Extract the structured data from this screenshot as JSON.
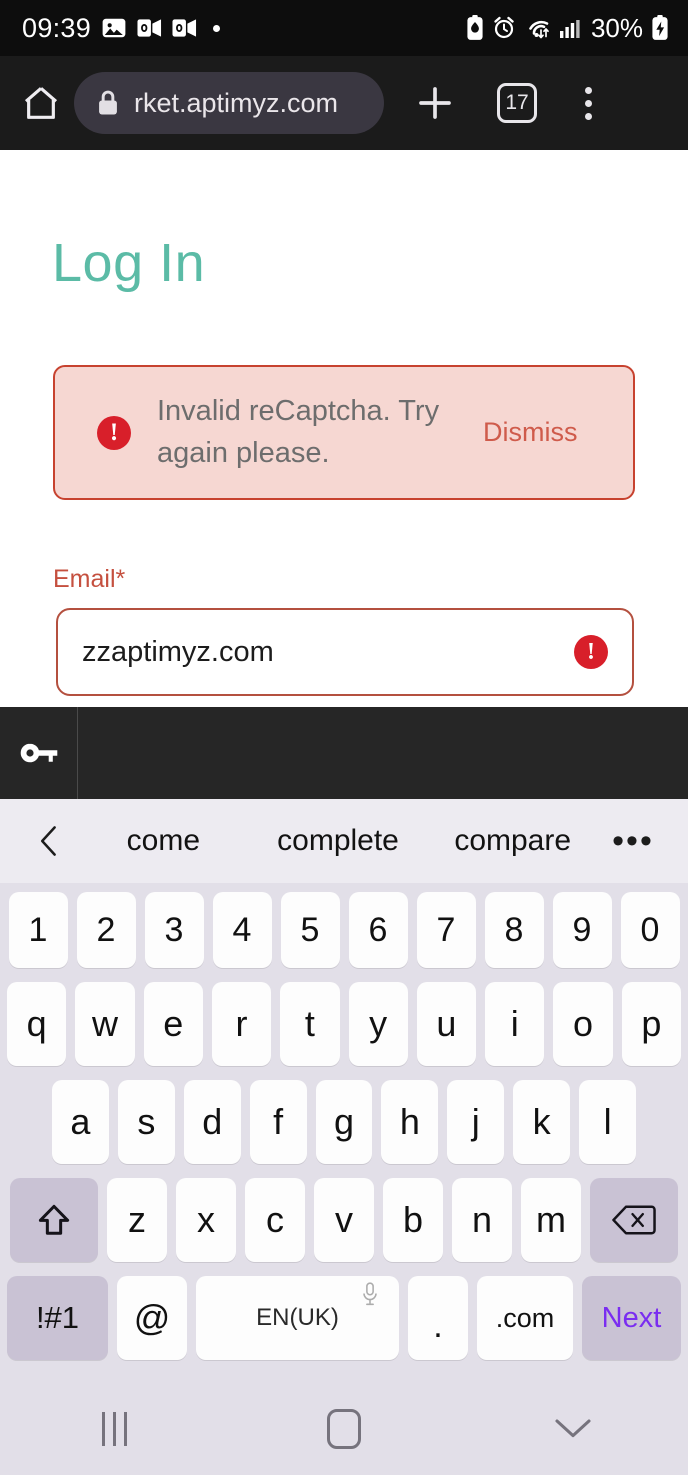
{
  "status_bar": {
    "time": "09:39",
    "battery_percent": "30%",
    "left_icons": [
      "photo-icon",
      "outlook-icon",
      "outlook-icon",
      "dot-indicator"
    ],
    "right_icons": [
      "battery-saver-icon",
      "alarm-icon",
      "wifi-icon",
      "signal-icon",
      "charging-battery-icon"
    ]
  },
  "browser": {
    "home_icon": "home-icon",
    "lock_icon": "lock-icon",
    "url": "rket.aptimyz.com",
    "new_tab_icon": "plus-icon",
    "tab_count": "17",
    "menu_icon": "overflow-menu-icon"
  },
  "page": {
    "title": "Log In",
    "title_color": "#5bbba6",
    "alert": {
      "icon": "error-icon",
      "message": "Invalid reCaptcha. Try again please.",
      "dismiss_label": "Dismiss",
      "background": "#f6d7d2",
      "border_color": "#c7422f",
      "text_color": "#6d6d6d",
      "dismiss_color": "#cf5b4b"
    },
    "email": {
      "label": "Email*",
      "value": "zzaptimyz.com",
      "placeholder": "Email",
      "error_icon": "error-icon",
      "label_color": "#c5503f",
      "border_color": "#b4503f"
    }
  },
  "autofill_bar": {
    "key_icon": "key-icon",
    "background": "#262626"
  },
  "keyboard": {
    "back_icon": "chevron-left-icon",
    "suggestions": [
      "come",
      "complete",
      "compare"
    ],
    "more_icon": "ellipsis-icon",
    "number_row": [
      "1",
      "2",
      "3",
      "4",
      "5",
      "6",
      "7",
      "8",
      "9",
      "0"
    ],
    "row_q": [
      "q",
      "w",
      "e",
      "r",
      "t",
      "y",
      "u",
      "i",
      "o",
      "p"
    ],
    "row_a": [
      "a",
      "s",
      "d",
      "f",
      "g",
      "h",
      "j",
      "k",
      "l"
    ],
    "row_z": [
      "z",
      "x",
      "c",
      "v",
      "b",
      "n",
      "m"
    ],
    "shift_icon": "shift-arrow-icon",
    "backspace_icon": "backspace-icon",
    "symbols_label": "!#1",
    "at_label": "@",
    "space_label": "EN(UK)",
    "mic_icon": "microphone-icon",
    "period_label": ".",
    "dotcom_label": ".com",
    "next_label": "Next",
    "next_color": "#7a2df0",
    "key_background": "#fdfdfd",
    "modifier_background": "#c9c2d4",
    "keyboard_background": "#e2dfe8"
  },
  "nav_bar": {
    "recents_icon": "recents-icon",
    "home_icon": "home-square-icon",
    "hide_keyboard_icon": "chevron-down-icon"
  }
}
